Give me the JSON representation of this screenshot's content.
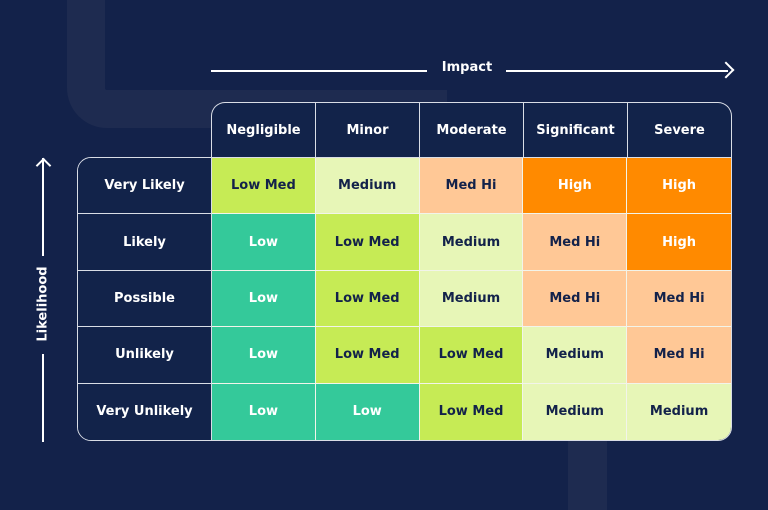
{
  "chart_data": {
    "type": "heatmap",
    "title": "",
    "xlabel": "Impact",
    "ylabel": "Likelihood",
    "x_categories": [
      "Negligible",
      "Minor",
      "Moderate",
      "Significant",
      "Severe"
    ],
    "y_categories": [
      "Very Likely",
      "Likely",
      "Possible",
      "Unlikely",
      "Very Unlikely"
    ],
    "values": [
      [
        "Low Med",
        "Medium",
        "Med Hi",
        "High",
        "High"
      ],
      [
        "Low",
        "Low Med",
        "Medium",
        "Med Hi",
        "High"
      ],
      [
        "Low",
        "Low Med",
        "Medium",
        "Med Hi",
        "Med Hi"
      ],
      [
        "Low",
        "Low Med",
        "Low Med",
        "Medium",
        "Med Hi"
      ],
      [
        "Low",
        "Low",
        "Low Med",
        "Medium",
        "Medium"
      ]
    ],
    "levels": {
      "Low": {
        "bg": "#34C99A",
        "fg": "#FFFFFF"
      },
      "Low Med": {
        "bg": "#C6EB55",
        "fg": "#13224A"
      },
      "Medium": {
        "bg": "#E7F6B7",
        "fg": "#13224A"
      },
      "Med Hi": {
        "bg": "#FFC896",
        "fg": "#13224A"
      },
      "High": {
        "bg": "#FF8A00",
        "fg": "#FFFFFF"
      }
    }
  },
  "colors": {
    "background": "#13224A",
    "grid_line": "#D9DDE6",
    "decoration": "#1E2B50"
  }
}
